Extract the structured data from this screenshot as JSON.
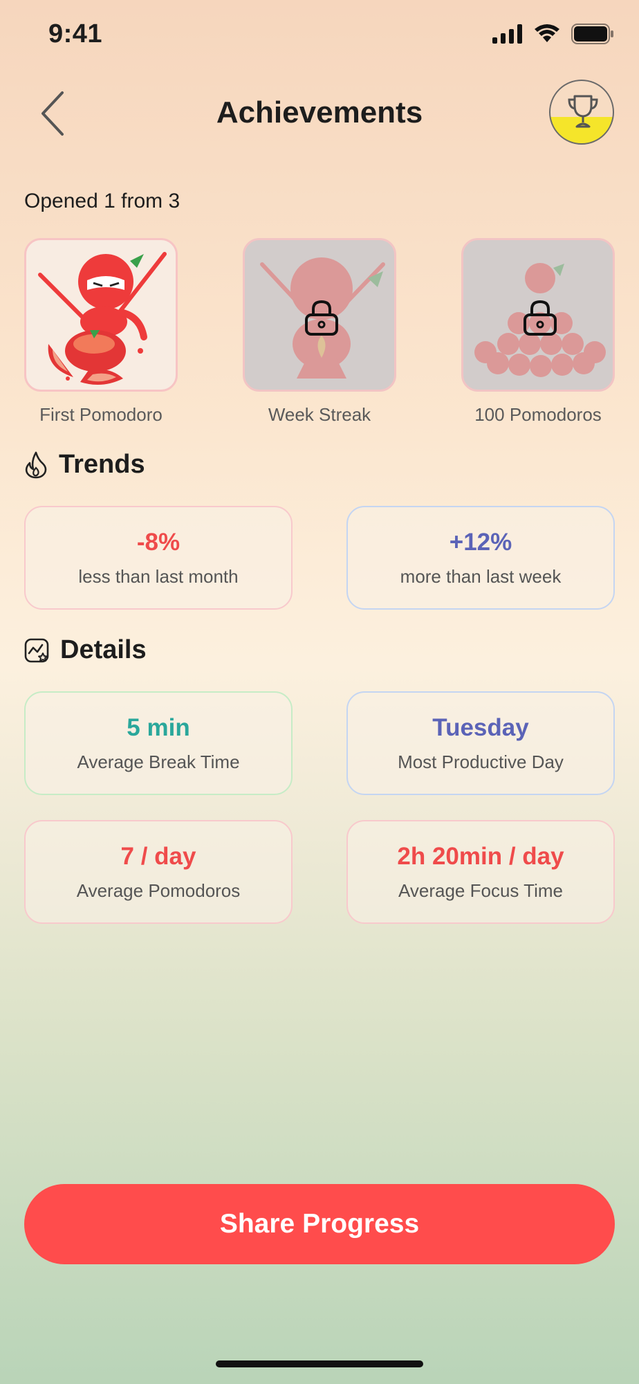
{
  "status": {
    "time": "9:41",
    "icons": [
      "cellular-signal-icon",
      "wifi-icon",
      "battery-icon"
    ]
  },
  "nav": {
    "title": "Achievements",
    "back_icon": "chevron-left-icon",
    "trophy_icon": "trophy-icon"
  },
  "opened_text": "Opened 1 from 3",
  "achievements": [
    {
      "label": "First Pomodoro",
      "locked": false
    },
    {
      "label": "Week Streak",
      "locked": true
    },
    {
      "label": "100 Pomodoros",
      "locked": true
    }
  ],
  "trends": {
    "title": "Trends",
    "icon": "flame-icon",
    "cards": [
      {
        "value": "-8%",
        "desc": "less than last month"
      },
      {
        "value": "+12%",
        "desc": "more than last week"
      }
    ]
  },
  "details": {
    "title": "Details",
    "icon": "chart-star-icon",
    "cards": [
      {
        "value": "5 min",
        "desc": "Average Break Time"
      },
      {
        "value": "Tuesday",
        "desc": "Most Productive Day"
      },
      {
        "value": "7 / day",
        "desc": "Average Pomodoros"
      },
      {
        "value": "2h 20min / day",
        "desc": "Average Focus Time"
      }
    ]
  },
  "share_label": "Share Progress",
  "colors": {
    "accent": "#ff4c4c",
    "red": "#ef4b4b",
    "indigo": "#5b63b7",
    "teal": "#2aa79b",
    "trophy_fill": "#f5e52a"
  }
}
